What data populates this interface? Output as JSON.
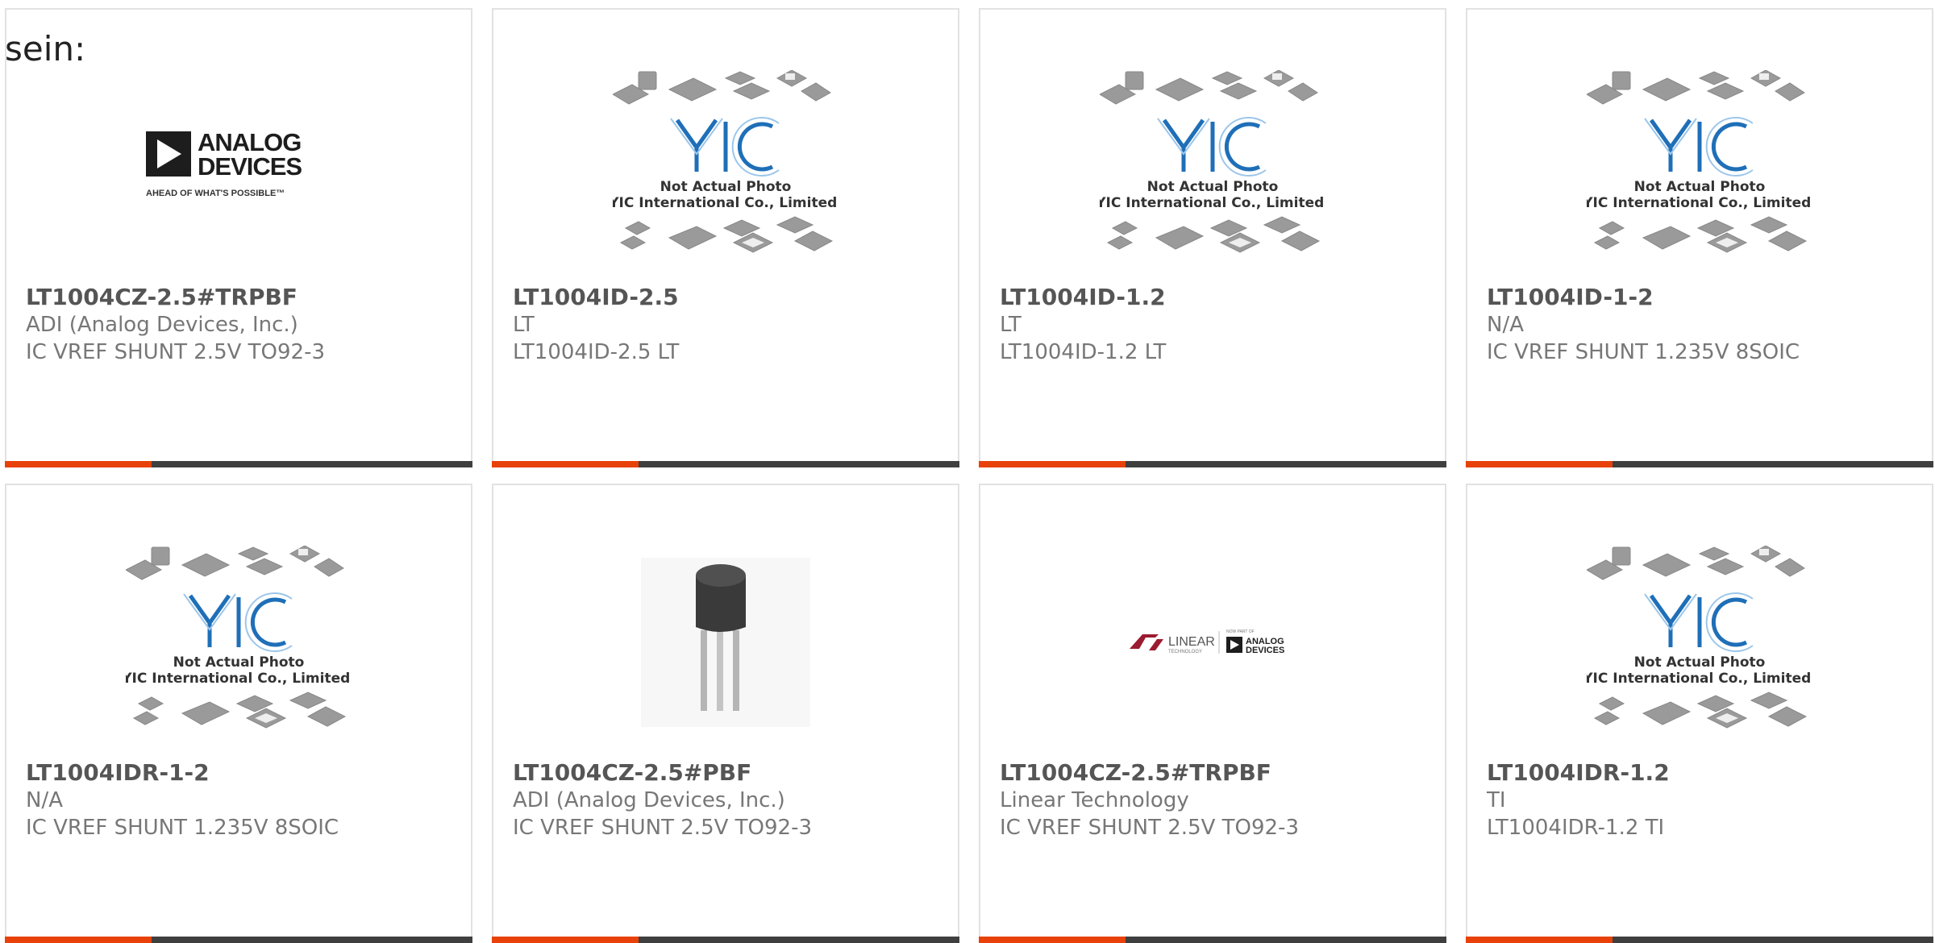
{
  "intro_text": "sein:",
  "colors": {
    "accent": "#e8420a",
    "bar": "#3f3f3f",
    "border": "#e2e2e2"
  },
  "placeholder": {
    "line1": "Not Actual Photo",
    "line2": "YIC International Co., Limited.",
    "logo": "YIC"
  },
  "adi_logo": {
    "line1": "ANALOG",
    "line2": "DEVICES",
    "tagline": "AHEAD OF WHAT'S POSSIBLE™"
  },
  "lt_logo": {
    "brand": "LINEAR",
    "sub": "TECHNOLOGY",
    "now": "NOW PART OF",
    "adi1": "ANALOG",
    "adi2": "DEVICES"
  },
  "products": [
    {
      "part": "LT1004CZ-2.5#TRPBF",
      "manufacturer": "ADI (Analog Devices, Inc.)",
      "description": "IC VREF SHUNT 2.5V TO92-3",
      "image": "adi-logo"
    },
    {
      "part": "LT1004ID-2.5",
      "manufacturer": "LT",
      "description": "LT1004ID-2.5 LT",
      "image": "placeholder"
    },
    {
      "part": "LT1004ID-1.2",
      "manufacturer": "LT",
      "description": "LT1004ID-1.2 LT",
      "image": "placeholder"
    },
    {
      "part": "LT1004ID-1-2",
      "manufacturer": "N/A",
      "description": "IC VREF SHUNT 1.235V 8SOIC",
      "image": "placeholder"
    },
    {
      "part": "LT1004IDR-1-2",
      "manufacturer": "N/A",
      "description": "IC VREF SHUNT 1.235V 8SOIC",
      "image": "placeholder"
    },
    {
      "part": "LT1004CZ-2.5#PBF",
      "manufacturer": "ADI (Analog Devices, Inc.)",
      "description": "IC VREF SHUNT 2.5V TO92-3",
      "image": "to92-photo"
    },
    {
      "part": "LT1004CZ-2.5#TRPBF",
      "manufacturer": "Linear Technology",
      "description": "IC VREF SHUNT 2.5V TO92-3",
      "image": "lt-logo"
    },
    {
      "part": "LT1004IDR-1.2",
      "manufacturer": "TI",
      "description": "LT1004IDR-1.2 TI",
      "image": "placeholder"
    }
  ]
}
